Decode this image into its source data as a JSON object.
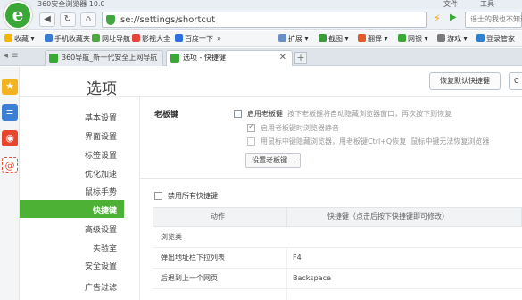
{
  "window": {
    "title": "360安全浏览器 10.0",
    "file_menu": "文件",
    "tools_menu": "工具"
  },
  "nav": {
    "back_label": "◀",
    "refresh_label": "↻",
    "home_label": "⌂",
    "address": "se://settings/shortcut",
    "search_placeholder": "谣士的我也不知道"
  },
  "bookmarks": {
    "items": [
      {
        "label": "收藏 ▾",
        "icon": "star-icon",
        "color": "#f5b400"
      },
      {
        "label": "手机收藏夹",
        "icon": "phone-icon",
        "color": "#3a7bd5"
      },
      {
        "label": "网址导航",
        "icon": "nav-icon",
        "color": "#4aa83c"
      },
      {
        "label": "影视大全",
        "icon": "video-icon",
        "color": "#e2463c"
      },
      {
        "label": "百度一下",
        "icon": "baidu-icon",
        "color": "#2f6fe0"
      },
      {
        "label": "»",
        "icon": "more-icon",
        "color": ""
      }
    ],
    "right": [
      {
        "label": "扩展 ▾",
        "icon": "puzzle-icon",
        "color": "#6a8fc4"
      },
      {
        "label": "截图 ▾",
        "icon": "scissors-icon",
        "color": "#3a9b3a"
      },
      {
        "label": "翻译 ▾",
        "icon": "translate-icon",
        "color": "#e05a2a"
      },
      {
        "label": "网银 ▾",
        "icon": "bank-icon",
        "color": "#3aa836"
      },
      {
        "label": "游戏 ▾",
        "icon": "game-icon",
        "color": "#7a7a7a"
      },
      {
        "label": "登录管家",
        "icon": "user-icon",
        "color": "#2f7fd0"
      }
    ]
  },
  "tabs": [
    {
      "label": "360导航_新一代安全上网导航",
      "active": false,
      "icon_color": "#3aa836"
    },
    {
      "label": "选项 - 快捷键",
      "active": true,
      "icon_color": "#3aa836"
    }
  ],
  "page": {
    "title": "选项",
    "restore_button": "恢复默认快捷键",
    "extra_button": "C"
  },
  "menu": {
    "items": [
      "基本设置",
      "界面设置",
      "标签设置",
      "优化加速",
      "鼠标手势",
      "快捷键",
      "高级设置",
      "实验室",
      "安全设置",
      "广告过滤"
    ],
    "active_index": 5
  },
  "boss": {
    "title": "老板键",
    "enable_label": "启用老板键",
    "enable_hint": "按下老板键将自动隐藏浏览器窗口，再次按下则恢复",
    "mute_label": "启用老板键时浏览器静音",
    "hide_label": "用鼠标中键隐藏浏览器，用老板键Ctrl+Q恢复",
    "hide_hint": "鼠标中键无法恢复浏览器",
    "set_button": "设置老板键..."
  },
  "shortcuts": {
    "disable_all_label": "禁用所有快捷键",
    "header_action": "动作",
    "header_key": "快捷键（点击后按下快捷键即可修改）",
    "group": "浏览类",
    "rows": [
      {
        "action": "弹出地址栏下拉列表",
        "key": "F4"
      },
      {
        "action": "后退到上一个网页",
        "key": "Backspace"
      }
    ]
  }
}
